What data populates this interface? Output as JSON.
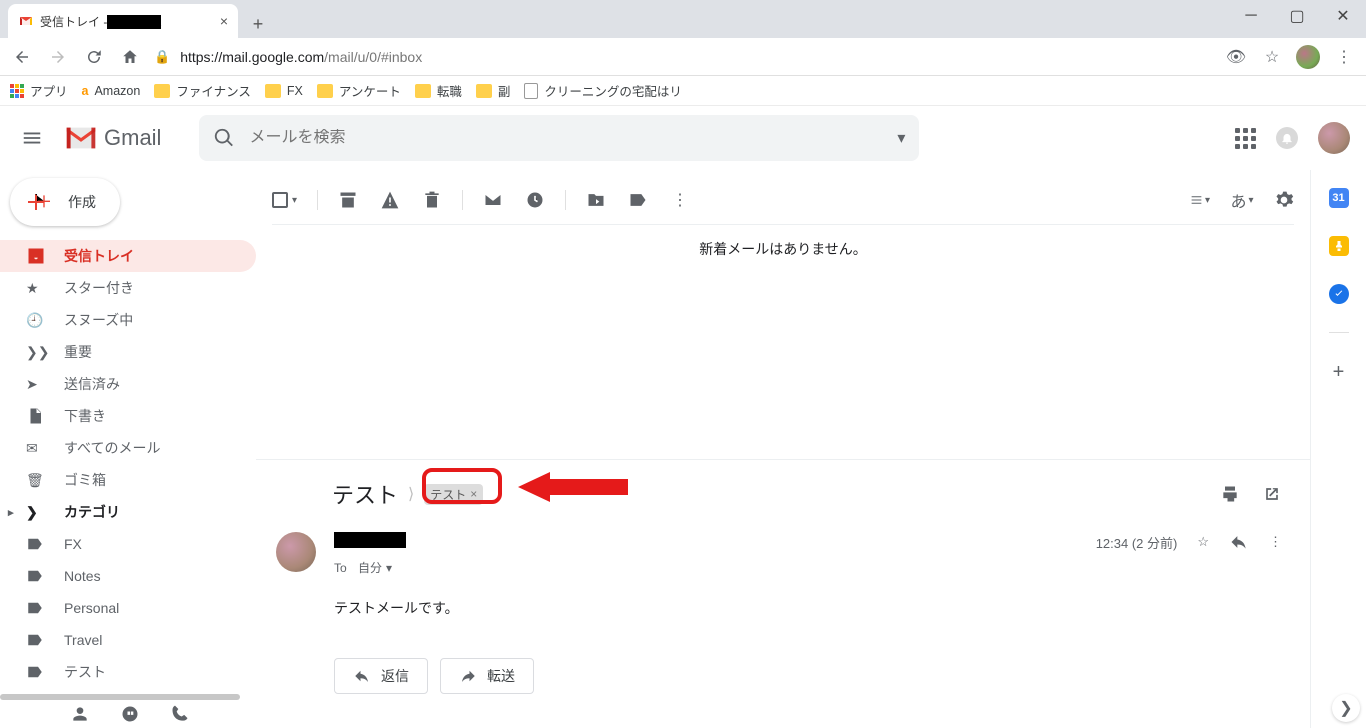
{
  "browser": {
    "tab_title": "受信トレイ -",
    "url_host": "https://mail.google.com",
    "url_path": "/mail/u/0/#inbox",
    "bookmarks": {
      "apps": "アプリ",
      "amazon": "Amazon",
      "finance": "ファイナンス",
      "fx": "FX",
      "survey": "アンケート",
      "job": "転職",
      "side": "副",
      "cleaning": "クリーニングの宅配はリ"
    }
  },
  "header": {
    "product": "Gmail",
    "search_placeholder": "メールを検索"
  },
  "compose_label": "作成",
  "sidebar": {
    "inbox": "受信トレイ",
    "starred": "スター付き",
    "snoozed": "スヌーズ中",
    "important": "重要",
    "sent": "送信済み",
    "drafts": "下書き",
    "all": "すべてのメール",
    "trash": "ゴミ箱",
    "categories": "カテゴリ",
    "labels": {
      "fx": "FX",
      "notes": "Notes",
      "personal": "Personal",
      "travel": "Travel",
      "test": "テスト"
    }
  },
  "toolbar": {
    "lang": "あ"
  },
  "empty_text": "新着メールはありません。",
  "message": {
    "subject": "テスト",
    "label": "テスト",
    "to_prefix": "To",
    "to_target": "自分",
    "time": "12:34 (2 分前)",
    "body": "テストメールです。",
    "reply": "返信",
    "forward": "転送"
  },
  "sidepanel": {
    "cal": "31"
  }
}
